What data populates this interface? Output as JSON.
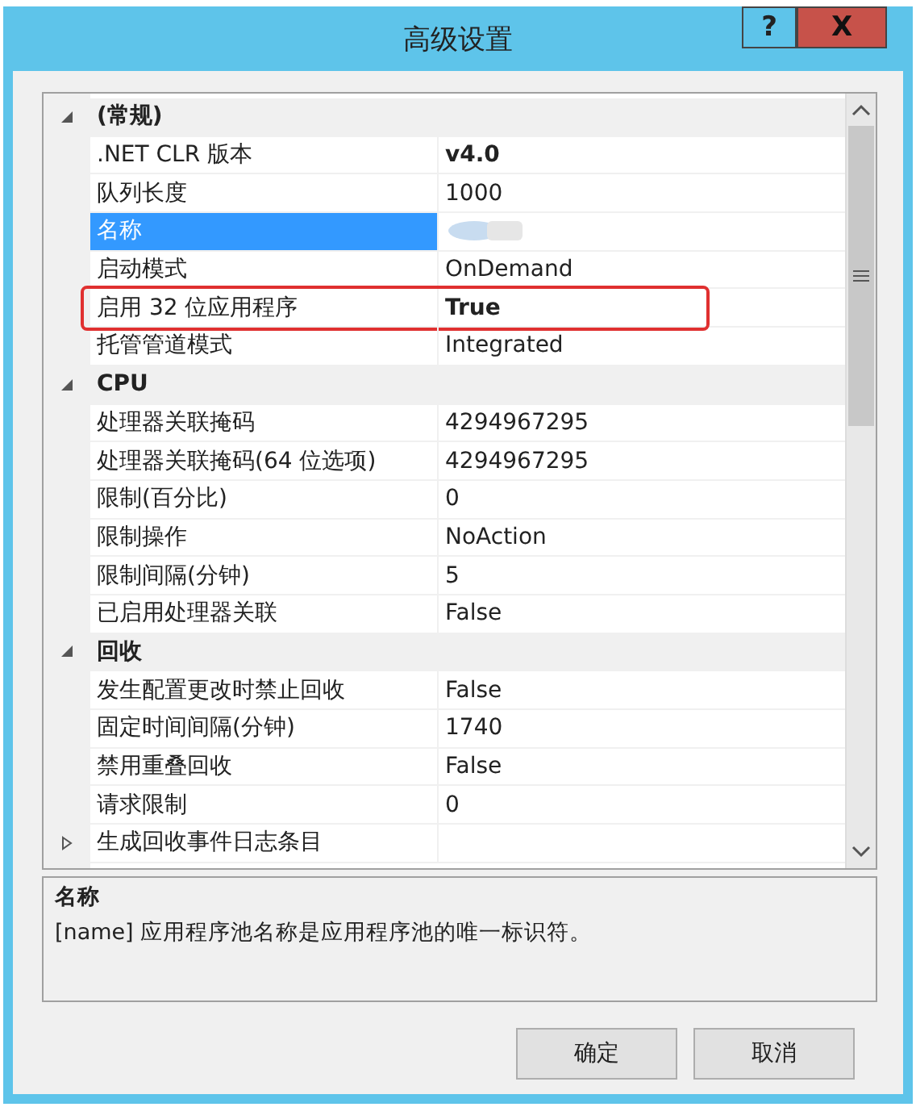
{
  "window": {
    "title": "高级设置",
    "help": "?",
    "close": "X"
  },
  "grid": {
    "rows": [
      {
        "kind": "category",
        "label": "(常规)",
        "expanded": true
      },
      {
        "kind": "property",
        "label": ".NET CLR 版本",
        "value": "v4.0",
        "bold": true,
        "selected": false,
        "highlighted": false
      },
      {
        "kind": "property",
        "label": "队列长度",
        "value": "1000",
        "bold": false,
        "selected": false,
        "highlighted": false
      },
      {
        "kind": "property",
        "label": "名称",
        "redacted": true,
        "selected": true,
        "highlighted": false
      },
      {
        "kind": "property",
        "label": "启动模式",
        "value": "OnDemand",
        "bold": false,
        "selected": false,
        "highlighted": false
      },
      {
        "kind": "property",
        "label": "启用 32 位应用程序",
        "value": "True",
        "bold": true,
        "selected": false,
        "highlighted": true
      },
      {
        "kind": "property",
        "label": "托管管道模式",
        "value": "Integrated",
        "bold": false,
        "selected": false,
        "highlighted": false
      },
      {
        "kind": "category",
        "label": "CPU",
        "expanded": true
      },
      {
        "kind": "property",
        "label": "处理器关联掩码",
        "value": "4294967295",
        "bold": false,
        "selected": false,
        "highlighted": false
      },
      {
        "kind": "property",
        "label": "处理器关联掩码(64 位选项)",
        "value": "4294967295",
        "bold": false,
        "selected": false,
        "highlighted": false
      },
      {
        "kind": "property",
        "label": "限制(百分比)",
        "value": "0",
        "bold": false,
        "selected": false,
        "highlighted": false
      },
      {
        "kind": "property",
        "label": "限制操作",
        "value": "NoAction",
        "bold": false,
        "selected": false,
        "highlighted": false
      },
      {
        "kind": "property",
        "label": "限制间隔(分钟)",
        "value": "5",
        "bold": false,
        "selected": false,
        "highlighted": false
      },
      {
        "kind": "property",
        "label": "已启用处理器关联",
        "value": "False",
        "bold": false,
        "selected": false,
        "highlighted": false
      },
      {
        "kind": "category",
        "label": "回收",
        "expanded": true
      },
      {
        "kind": "property",
        "label": "发生配置更改时禁止回收",
        "value": "False",
        "bold": false,
        "selected": false,
        "highlighted": false
      },
      {
        "kind": "property",
        "label": "固定时间间隔(分钟)",
        "value": "1740",
        "bold": false,
        "selected": false,
        "highlighted": false
      },
      {
        "kind": "property",
        "label": "禁用重叠回收",
        "value": "False",
        "bold": false,
        "selected": false,
        "highlighted": false
      },
      {
        "kind": "property",
        "label": "请求限制",
        "value": "0",
        "bold": false,
        "selected": false,
        "highlighted": false
      },
      {
        "kind": "expandable",
        "label": "生成回收事件日志条目",
        "expanded": false
      }
    ]
  },
  "description": {
    "title": "名称",
    "text": "[name] 应用程序池名称是应用程序池的唯一标识符。"
  },
  "buttons": [
    "确定",
    "取消"
  ]
}
